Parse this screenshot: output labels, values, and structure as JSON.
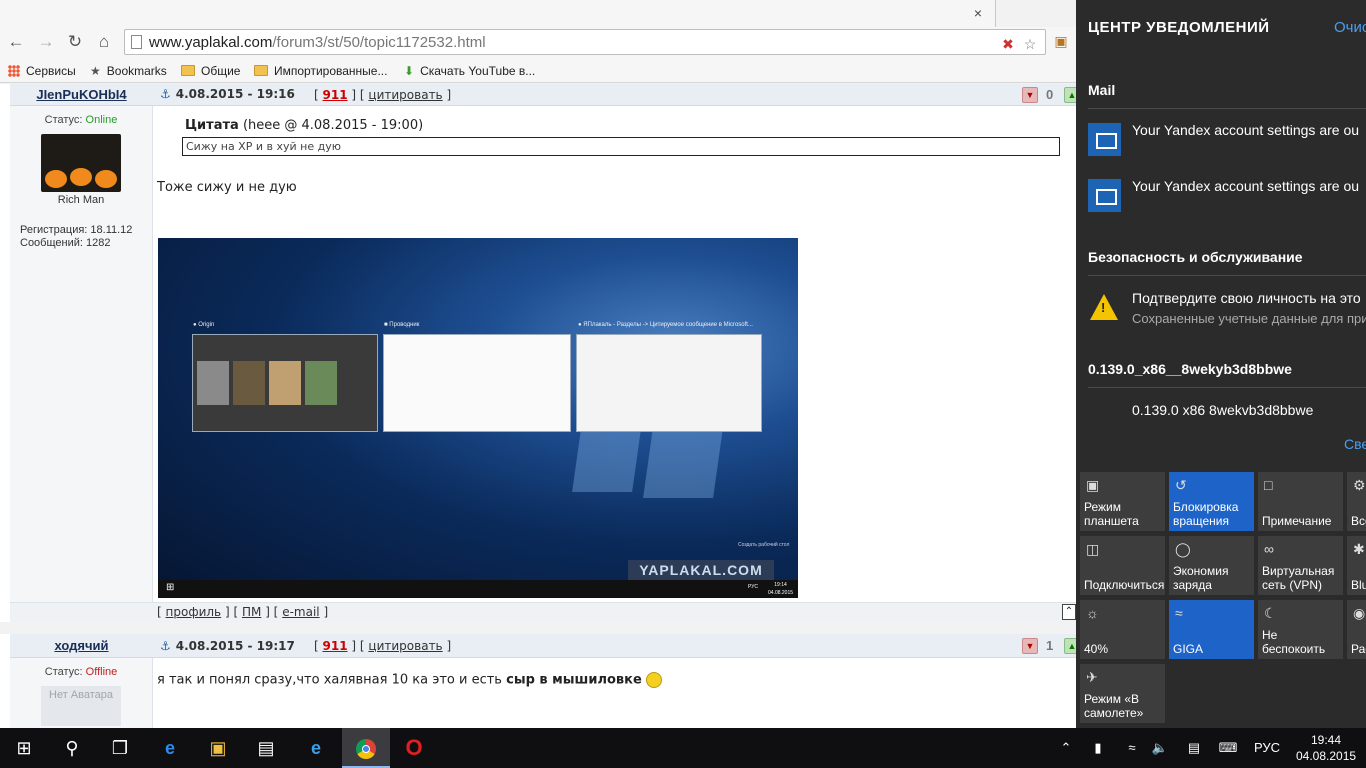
{
  "browser": {
    "tab_close": "×",
    "url_host": "www.yaplakal.com",
    "url_path": "/forum3/st/50/topic1172532.html",
    "bookmarks": [
      "Сервисы",
      "Bookmarks",
      "Общие",
      "Импортированные...",
      "Скачать YouTube в..."
    ]
  },
  "post1": {
    "author": "JIenPuKOHbI4",
    "date": "4.08.2015 - 19:16",
    "karma_open": "[",
    "karma_num": "911",
    "karma_mid": "] [",
    "cite": "цитировать",
    "karma_close": "]",
    "vote_count": "0",
    "status_label": "Статус:",
    "status_value": "Online",
    "rank": "Rich Man",
    "reg_label": "Регистрация: 18.11.12",
    "msgs_label": "Сообщений: 1282",
    "quote_title": "Цитата",
    "quote_meta": "(heee @ 4.08.2015 - 19:00)",
    "quote_text": "Сижу на ХР и в хуй не дую",
    "body": "Тоже сижу и не дую",
    "footer": {
      "open": "[",
      "profile": "профиль",
      "pm": "ПМ",
      "email": "e-mail",
      "sep": "] [",
      "close": "]"
    }
  },
  "screenshot": {
    "win1_title": "Origin",
    "win2_title": "Проводник",
    "win3_title": "ЯПлакаль - Разделы -> Цитируемое сообщение в Microsoft...",
    "watermark": "YAPLAKAL.COM",
    "desktop_label": "Создать рабочий стол",
    "lang": "РУС",
    "time": "19:14",
    "date": "04.08.2015"
  },
  "post2": {
    "author": "ходячий",
    "date": "4.08.2015 - 19:17",
    "karma_open": "[",
    "karma_num": "911",
    "karma_mid": "] [",
    "cite": "цитировать",
    "karma_close": "]",
    "vote_count": "1",
    "status_label": "Статус:",
    "status_value": "Offline",
    "noavatar": "Нет Аватара",
    "body_plain": "я так и понял сразу,что халявная 10 ка это и есть",
    "body_bold": "сыр в мышиловке"
  },
  "action_center": {
    "title": "ЦЕНТР УВЕДОМЛЕНИЙ",
    "clear": "Очис",
    "mail_header": "Mail",
    "mail1": "Your Yandex account settings are ou",
    "mail2": "Your Yandex account settings are ou",
    "security_header": "Безопасность и обслуживание",
    "security_text": "Подтвердите свою личность на это",
    "security_sub": "Сохраненные учетные данные для при",
    "app_header": "0.139.0_x86__8wekyb3d8bbwe",
    "app_text": "0.139.0 x86   8wekvb3d8bbwe",
    "collapse": "Све",
    "tiles": [
      {
        "label": "Режим планшета",
        "on": false
      },
      {
        "label": "Блокировка вращения",
        "on": true
      },
      {
        "label": "Примечание",
        "on": false
      },
      {
        "label": "Все пар",
        "on": false
      },
      {
        "label": "Подключиться",
        "on": false
      },
      {
        "label": "Экономия заряда",
        "on": false
      },
      {
        "label": "Виртуальная сеть (VPN)",
        "on": false
      },
      {
        "label": "Blu",
        "on": false
      },
      {
        "label": "40%",
        "on": false
      },
      {
        "label": "GIGA",
        "on": true
      },
      {
        "label": "Не беспокоить",
        "on": false
      },
      {
        "label": "Рас",
        "on": false
      },
      {
        "label": "Режим «В самолете»",
        "on": false
      }
    ]
  },
  "taskbar": {
    "lang": "РУС",
    "time": "19:44",
    "date": "04.08.2015"
  }
}
